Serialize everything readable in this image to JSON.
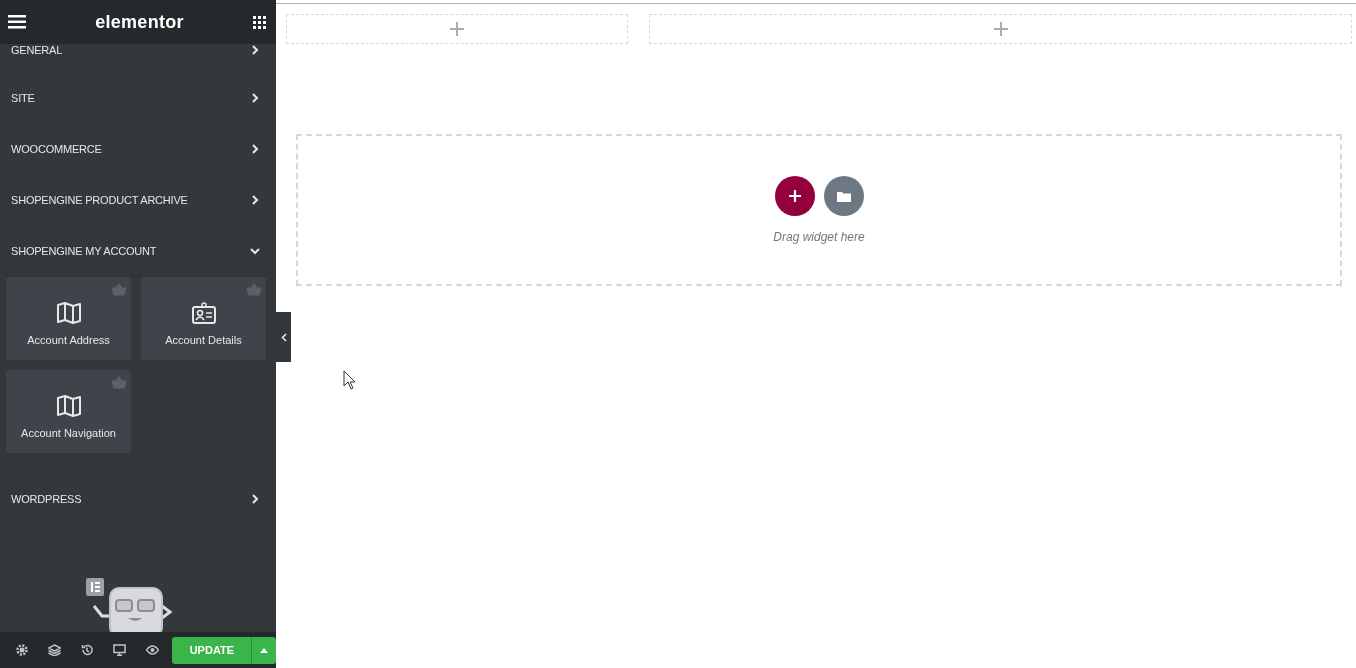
{
  "header": {
    "logo": "elementor"
  },
  "categories": [
    {
      "title": "GENERAL",
      "expanded": false
    },
    {
      "title": "SITE",
      "expanded": false
    },
    {
      "title": "WOOCOMMERCE",
      "expanded": false
    },
    {
      "title": "SHOPENGINE PRODUCT ARCHIVE",
      "expanded": false
    },
    {
      "title": "SHOPENGINE MY ACCOUNT",
      "expanded": true,
      "widgets": [
        {
          "label": "Account Address",
          "kind": "map"
        },
        {
          "label": "Account Details",
          "kind": "id-card"
        },
        {
          "label": "Account Navigation",
          "kind": "map"
        }
      ]
    },
    {
      "title": "WORDPRESS",
      "expanded": false
    }
  ],
  "footer": {
    "update_button": "UPDATE"
  },
  "canvas": {
    "drop_hint": "Drag widget here"
  }
}
